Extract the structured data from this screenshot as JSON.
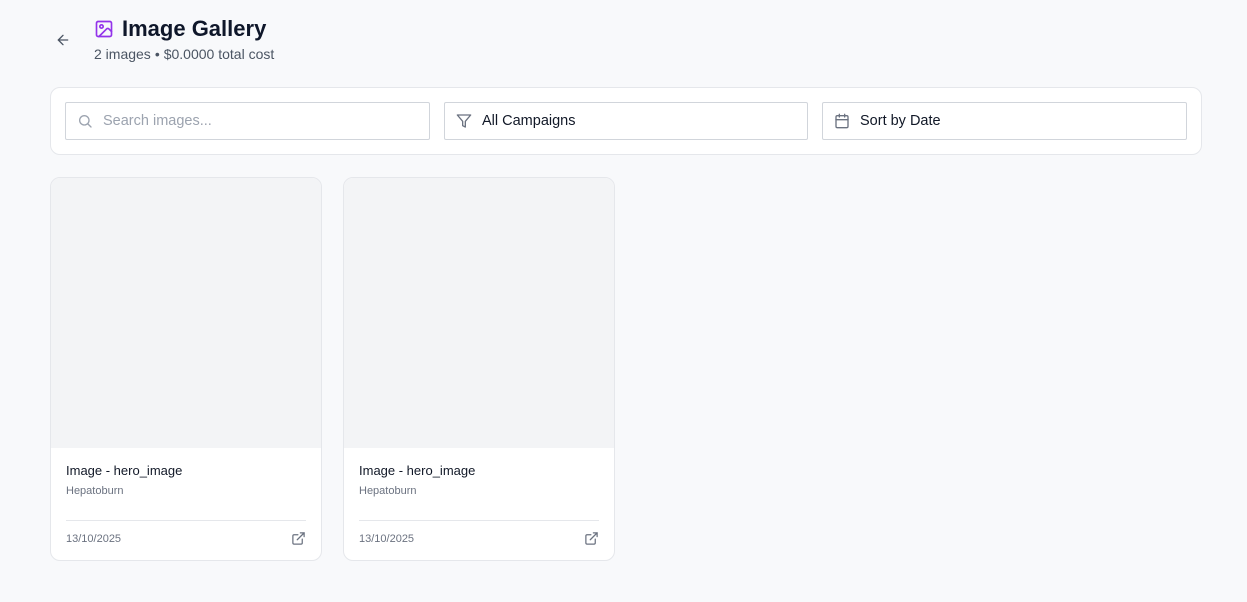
{
  "header": {
    "title": "Image Gallery",
    "image_count": "2 images",
    "separator": "•",
    "total_cost": "$0.0000 total cost",
    "accent_color": "#9333ea"
  },
  "filters": {
    "search_placeholder": "Search images...",
    "campaign_value": "All Campaigns",
    "sort_value": "Sort by Date"
  },
  "cards": [
    {
      "title": "Image - hero_image",
      "campaign": "Hepatoburn",
      "date": "13/10/2025"
    },
    {
      "title": "Image - hero_image",
      "campaign": "Hepatoburn",
      "date": "13/10/2025"
    }
  ]
}
